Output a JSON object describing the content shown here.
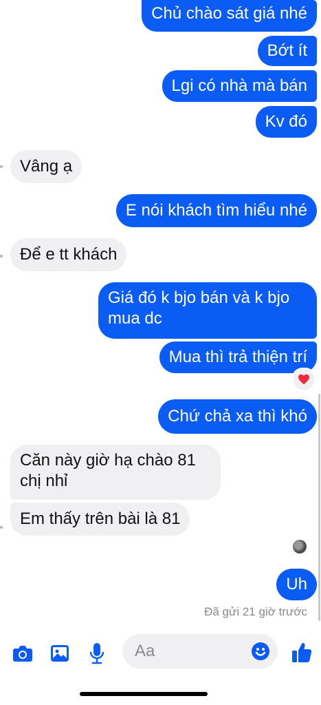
{
  "messages": [
    {
      "dir": "out",
      "text": "Chủ chào sát giá nhé"
    },
    {
      "dir": "out",
      "text": "Bớt ít"
    },
    {
      "dir": "out",
      "text": "Lgi có nhà mà bán"
    },
    {
      "dir": "out",
      "text": "Kv đó"
    },
    {
      "dir": "in",
      "text": "Vâng ạ"
    },
    {
      "dir": "out",
      "text": "E nói khách tìm hiểu nhé"
    },
    {
      "dir": "in",
      "text": "Để e tt khách"
    },
    {
      "dir": "out",
      "text": "Giá đó k bjo bán và k bjo mua dc"
    },
    {
      "dir": "out",
      "text": "Mua thì trả thiện trí",
      "reaction": "❤️"
    },
    {
      "dir": "out",
      "text": "Chứ chả xa thì khó"
    },
    {
      "dir": "in",
      "text": "Căn này giờ hạ chào 81 chị nhỉ"
    },
    {
      "dir": "in",
      "text": "Em thấy trên bài là 81"
    },
    {
      "dir": "out",
      "text": "Uh"
    }
  ],
  "status_text": "Đã gửi 21 giờ trước",
  "composer": {
    "placeholder": "Aa",
    "icons": [
      "camera-icon",
      "image-icon",
      "microphone-icon",
      "emoji-icon",
      "thumbs-up-icon"
    ]
  },
  "colors": {
    "outgoing_bubble": "#0a5cf5",
    "incoming_bubble": "#f0f0f2",
    "accent": "#0a5cf5"
  }
}
